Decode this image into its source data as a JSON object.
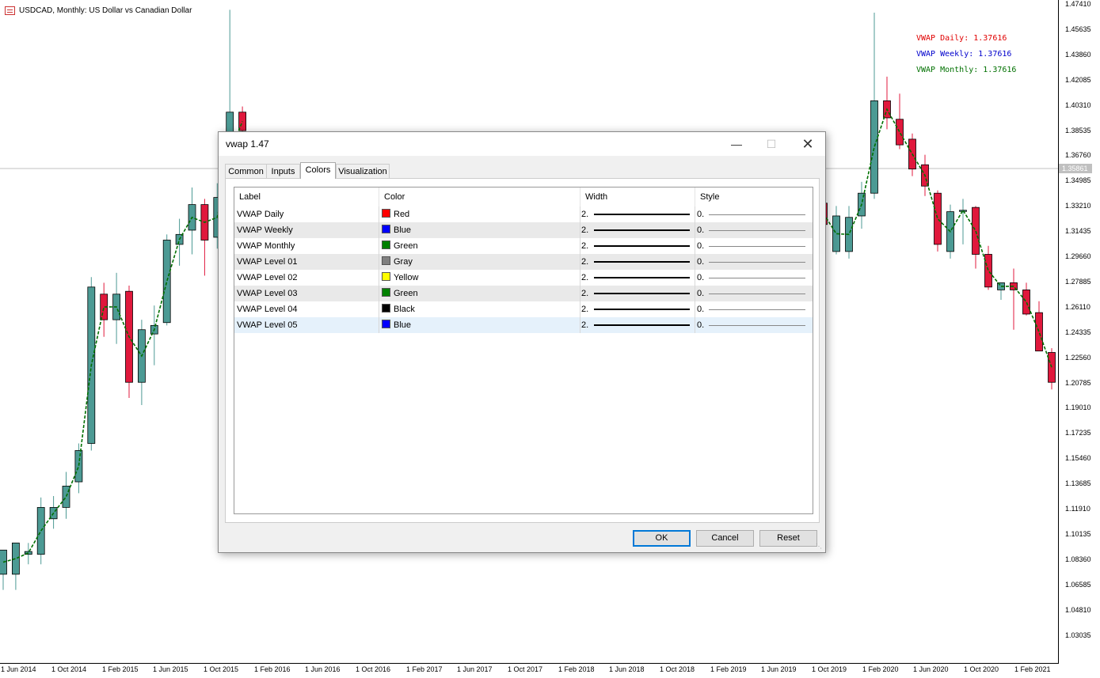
{
  "chart": {
    "title": "USDCAD, Monthly:  US Dollar vs Canadian Dollar",
    "current_price": "1.35861",
    "price_labels": [
      "1.47410",
      "1.45635",
      "1.43860",
      "1.42085",
      "1.40310",
      "1.38535",
      "1.36760",
      "1.34985",
      "1.33210",
      "1.31435",
      "1.29660",
      "1.27885",
      "1.26110",
      "1.24335",
      "1.22560",
      "1.20785",
      "1.19010",
      "1.17235",
      "1.15460",
      "1.13685",
      "1.11910",
      "1.10135",
      "1.08360",
      "1.06585",
      "1.04810",
      "1.03035"
    ],
    "date_labels": [
      "1 Jun 2014",
      "1 Oct 2014",
      "1 Feb 2015",
      "1 Jun 2015",
      "1 Oct 2015",
      "1 Feb 2016",
      "1 Jun 2016",
      "1 Oct 2016",
      "1 Feb 2017",
      "1 Jun 2017",
      "1 Oct 2017",
      "1 Feb 2018",
      "1 Jun 2018",
      "1 Oct 2018",
      "1 Feb 2019",
      "1 Jun 2019",
      "1 Oct 2019",
      "1 Feb 2020",
      "1 Jun 2020",
      "1 Oct 2020",
      "1 Feb 2021"
    ],
    "legend": [
      {
        "text": "VWAP Daily: 1.37616",
        "color": "#e00000"
      },
      {
        "text": "VWAP Weekly: 1.37616",
        "color": "#0000cc"
      },
      {
        "text": "VWAP Monthly: 1.37616",
        "color": "#007000"
      }
    ],
    "up_color": "#4c9a94",
    "down_color": "#e0183c"
  },
  "chart_data": {
    "type": "candlestick",
    "title": "USDCAD, Monthly:  US Dollar vs Canadian Dollar",
    "ylim": [
      1.02,
      1.48
    ],
    "candles_left": [
      {
        "o": 1.073,
        "h": 1.083,
        "l": 1.062,
        "c": 1.09
      },
      {
        "o": 1.073,
        "h": 1.095,
        "l": 1.062,
        "c": 1.095
      },
      {
        "o": 1.087,
        "h": 1.095,
        "l": 1.08,
        "c": 1.089
      },
      {
        "o": 1.087,
        "h": 1.127,
        "l": 1.08,
        "c": 1.12
      },
      {
        "o": 1.112,
        "h": 1.128,
        "l": 1.105,
        "c": 1.12
      },
      {
        "o": 1.12,
        "h": 1.145,
        "l": 1.112,
        "c": 1.135
      },
      {
        "o": 1.138,
        "h": 1.165,
        "l": 1.13,
        "c": 1.16
      },
      {
        "o": 1.165,
        "h": 1.282,
        "l": 1.16,
        "c": 1.275
      },
      {
        "o": 1.27,
        "h": 1.278,
        "l": 1.24,
        "c": 1.252
      },
      {
        "o": 1.252,
        "h": 1.285,
        "l": 1.235,
        "c": 1.27
      },
      {
        "o": 1.272,
        "h": 1.276,
        "l": 1.197,
        "c": 1.208
      },
      {
        "o": 1.208,
        "h": 1.252,
        "l": 1.192,
        "c": 1.245
      },
      {
        "o": 1.242,
        "h": 1.262,
        "l": 1.22,
        "c": 1.248
      },
      {
        "o": 1.25,
        "h": 1.312,
        "l": 1.248,
        "c": 1.308
      },
      {
        "o": 1.305,
        "h": 1.323,
        "l": 1.29,
        "c": 1.312
      },
      {
        "o": 1.315,
        "h": 1.345,
        "l": 1.298,
        "c": 1.333
      },
      {
        "o": 1.333,
        "h": 1.337,
        "l": 1.283,
        "c": 1.308
      },
      {
        "o": 1.31,
        "h": 1.348,
        "l": 1.302,
        "c": 1.338
      },
      {
        "o": 1.34,
        "h": 1.47,
        "l": 1.33,
        "c": 1.398
      },
      {
        "o": 1.398,
        "h": 1.402,
        "l": 1.38,
        "c": 1.385
      }
    ],
    "candles_right": [
      {
        "o": 1.334,
        "h": 1.338,
        "l": 1.312,
        "c": 1.319
      },
      {
        "o": 1.3,
        "h": 1.332,
        "l": 1.298,
        "c": 1.325
      },
      {
        "o": 1.3,
        "h": 1.332,
        "l": 1.295,
        "c": 1.324
      },
      {
        "o": 1.325,
        "h": 1.349,
        "l": 1.316,
        "c": 1.341
      },
      {
        "o": 1.341,
        "h": 1.468,
        "l": 1.337,
        "c": 1.406
      },
      {
        "o": 1.406,
        "h": 1.423,
        "l": 1.386,
        "c": 1.394
      },
      {
        "o": 1.393,
        "h": 1.411,
        "l": 1.372,
        "c": 1.375
      },
      {
        "o": 1.379,
        "h": 1.383,
        "l": 1.353,
        "c": 1.358
      },
      {
        "o": 1.361,
        "h": 1.368,
        "l": 1.339,
        "c": 1.346
      },
      {
        "o": 1.341,
        "h": 1.343,
        "l": 1.3,
        "c": 1.305
      },
      {
        "o": 1.3,
        "h": 1.333,
        "l": 1.295,
        "c": 1.328
      },
      {
        "o": 1.329,
        "h": 1.337,
        "l": 1.305,
        "c": 1.329
      },
      {
        "o": 1.331,
        "h": 1.332,
        "l": 1.288,
        "c": 1.298
      },
      {
        "o": 1.298,
        "h": 1.304,
        "l": 1.273,
        "c": 1.275
      },
      {
        "o": 1.273,
        "h": 1.277,
        "l": 1.266,
        "c": 1.278
      },
      {
        "o": 1.278,
        "h": 1.288,
        "l": 1.245,
        "c": 1.273
      },
      {
        "o": 1.273,
        "h": 1.278,
        "l": 1.255,
        "c": 1.256
      },
      {
        "o": 1.257,
        "h": 1.265,
        "l": 1.233,
        "c": 1.23
      },
      {
        "o": 1.229,
        "h": 1.232,
        "l": 1.203,
        "c": 1.208
      }
    ]
  },
  "dialog": {
    "title": "vwap 1.47",
    "tabs": [
      "Common",
      "Inputs",
      "Colors",
      "Visualization"
    ],
    "active_tab": "Colors",
    "columns": [
      "Label",
      "Color",
      "Width",
      "Style"
    ],
    "rows": [
      {
        "label": "VWAP Daily",
        "color_name": "Red",
        "color": "#ff0000",
        "width": "2.",
        "style": "0."
      },
      {
        "label": "VWAP Weekly",
        "color_name": "Blue",
        "color": "#0000ff",
        "width": "2.",
        "style": "0."
      },
      {
        "label": "VWAP Monthly",
        "color_name": "Green",
        "color": "#008000",
        "width": "2.",
        "style": "0."
      },
      {
        "label": "VWAP Level 01",
        "color_name": "Gray",
        "color": "#808080",
        "width": "2.",
        "style": "0."
      },
      {
        "label": "VWAP Level 02",
        "color_name": "Yellow",
        "color": "#ffff00",
        "width": "2.",
        "style": "0."
      },
      {
        "label": "VWAP Level 03",
        "color_name": "Green",
        "color": "#008000",
        "width": "2.",
        "style": "0."
      },
      {
        "label": "VWAP Level 04",
        "color_name": "Black",
        "color": "#000000",
        "width": "2.",
        "style": "0."
      },
      {
        "label": "VWAP Level 05",
        "color_name": "Blue",
        "color": "#0000ff",
        "width": "2.",
        "style": "0."
      }
    ],
    "buttons": {
      "ok": "OK",
      "cancel": "Cancel",
      "reset": "Reset"
    }
  }
}
